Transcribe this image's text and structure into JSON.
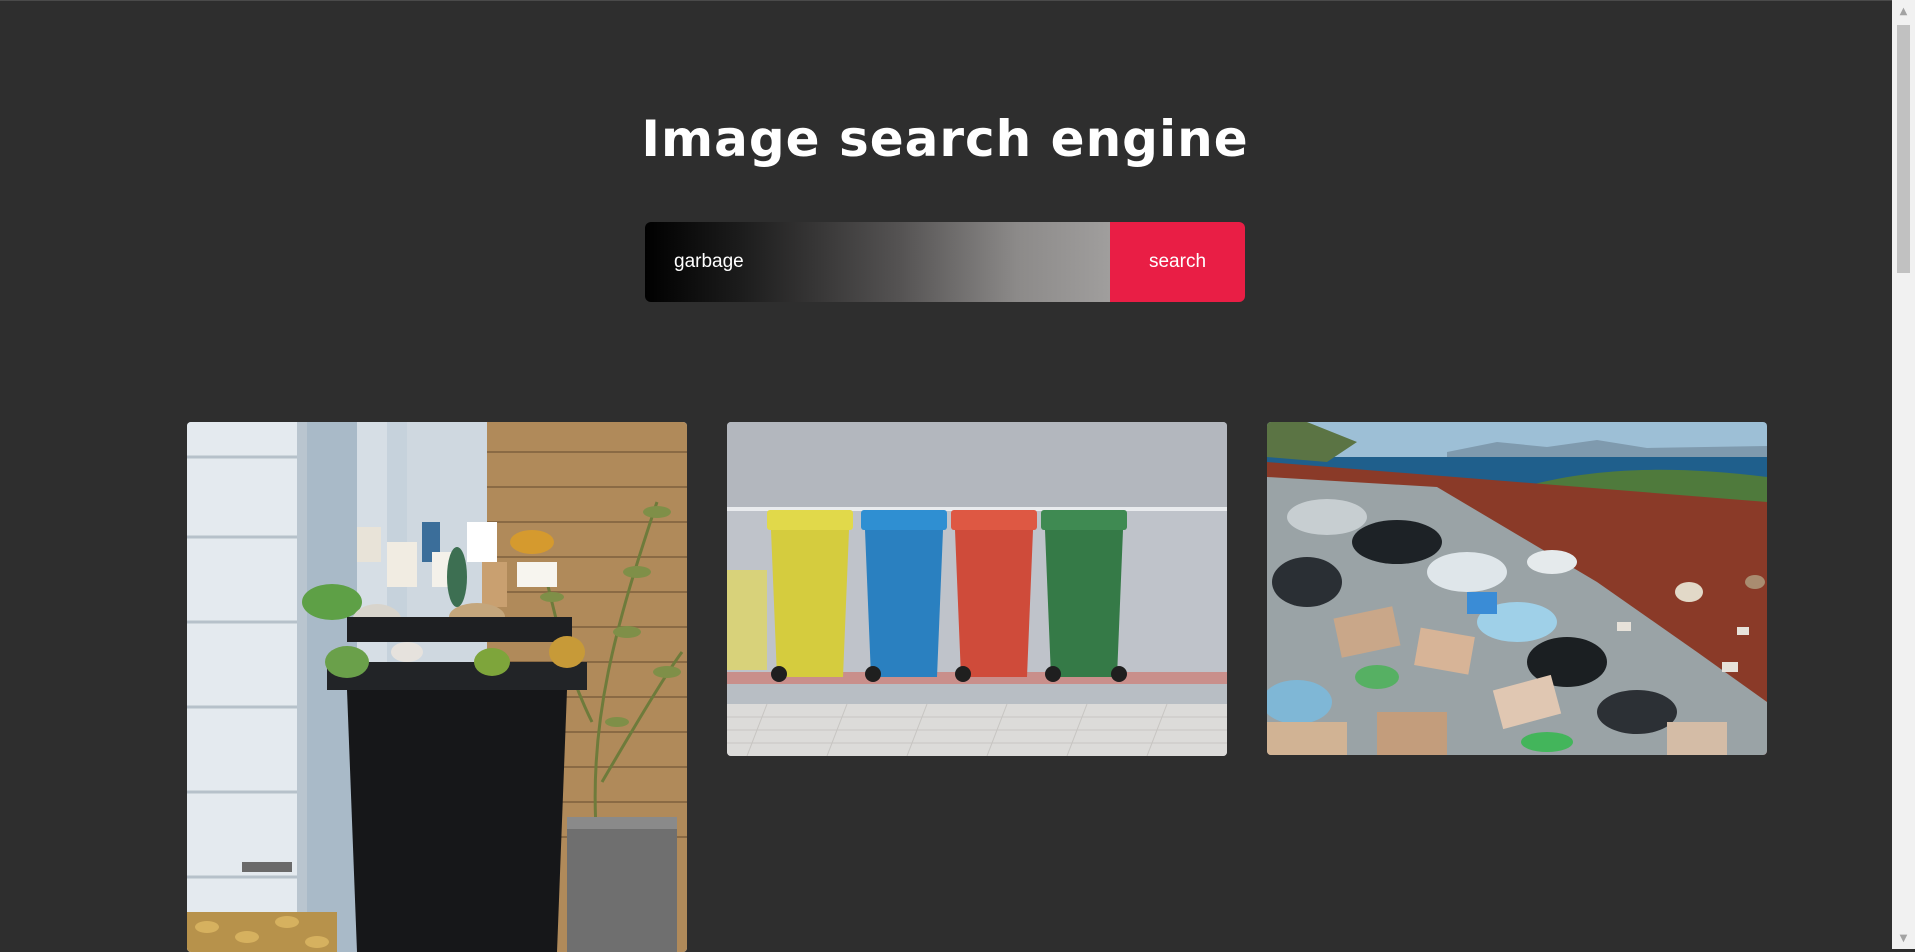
{
  "header": {
    "title": "Image search engine"
  },
  "search": {
    "query": "garbage",
    "button_label": "search"
  },
  "results": [
    {
      "subject": "overflowing black wheelie bin by brick wall"
    },
    {
      "subject": "yellow, blue, red and green wheelie bins"
    },
    {
      "subject": "garbage dump near the sea"
    }
  ],
  "colors": {
    "page_background": "#2e2e2e",
    "search_button": "#e91e45",
    "title_text": "#ffffff"
  }
}
